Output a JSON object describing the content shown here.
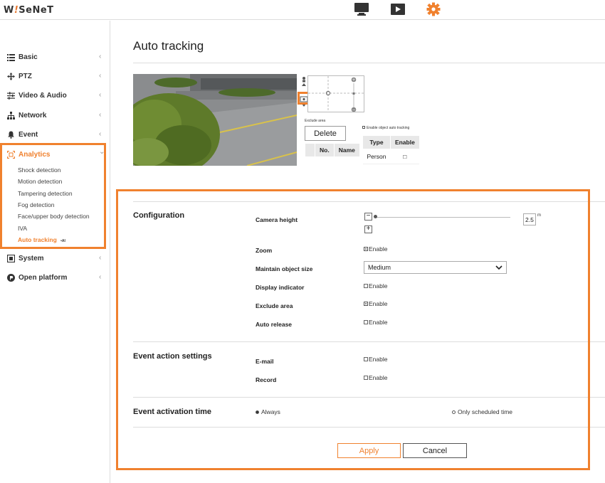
{
  "brand": {
    "prefix": "W",
    "ital": "!",
    "suffix": "SeNeT"
  },
  "topnav": {
    "icons": [
      "monitor-icon",
      "playback-icon",
      "settings-gear-icon"
    ]
  },
  "sidebar": {
    "items": [
      {
        "label": "Basic",
        "icon": "list-icon"
      },
      {
        "label": "PTZ",
        "icon": "ptz-arrows-icon"
      },
      {
        "label": "Video & Audio",
        "icon": "sliders-icon"
      },
      {
        "label": "Network",
        "icon": "network-icon"
      },
      {
        "label": "Event",
        "icon": "bell-icon"
      },
      {
        "label": "Analytics",
        "icon": "analytics-frame-icon"
      },
      {
        "label": "System",
        "icon": "system-icon"
      },
      {
        "label": "Open platform",
        "icon": "open-platform-icon"
      }
    ],
    "analytics_sub": [
      "Shock detection",
      "Motion detection",
      "Tampering detection",
      "Fog detection",
      "Face/upper body detection",
      "IVA",
      "Auto tracking"
    ],
    "auto_tracking_badge": "•AI",
    "chevron": "‹",
    "chevron_down": "⌄"
  },
  "page": {
    "title": "Auto tracking"
  },
  "preview": {
    "exclude_area_label": "Exclude area",
    "delete_button": "Delete",
    "exclude_table": {
      "headers": [
        "No.",
        "Name"
      ]
    },
    "enable_object_label": "Enable object auto tracking",
    "object_table": {
      "headers": [
        "Type",
        "Enable"
      ],
      "rows": [
        [
          "Person",
          "□"
        ]
      ]
    }
  },
  "configuration": {
    "title": "Configuration",
    "camera_height": {
      "label": "Camera height",
      "value": "2.5",
      "unit": "m",
      "minus": "−",
      "plus": "+"
    },
    "zoom": {
      "label": "Zoom",
      "option": "Enable",
      "checked": true
    },
    "maintain_object_size": {
      "label": "Maintain object size",
      "value": "Medium"
    },
    "display_indicator": {
      "label": "Display indicator",
      "option": "Enable",
      "checked": false
    },
    "exclude_area": {
      "label": "Exclude area",
      "option": "Enable",
      "checked": true
    },
    "auto_release": {
      "label": "Auto release",
      "option": "Enable",
      "checked": false
    }
  },
  "event_action": {
    "title": "Event action settings",
    "email": {
      "label": "E-mail",
      "option": "Enable",
      "checked": false
    },
    "record": {
      "label": "Record",
      "option": "Enable",
      "checked": false
    }
  },
  "event_activation": {
    "title": "Event activation time",
    "always": "Always",
    "scheduled": "Only scheduled time",
    "selected": "always"
  },
  "footer": {
    "apply": "Apply",
    "cancel": "Cancel"
  },
  "colors": {
    "accent": "#f0812e",
    "text": "#222222",
    "rule": "#dddddd"
  }
}
